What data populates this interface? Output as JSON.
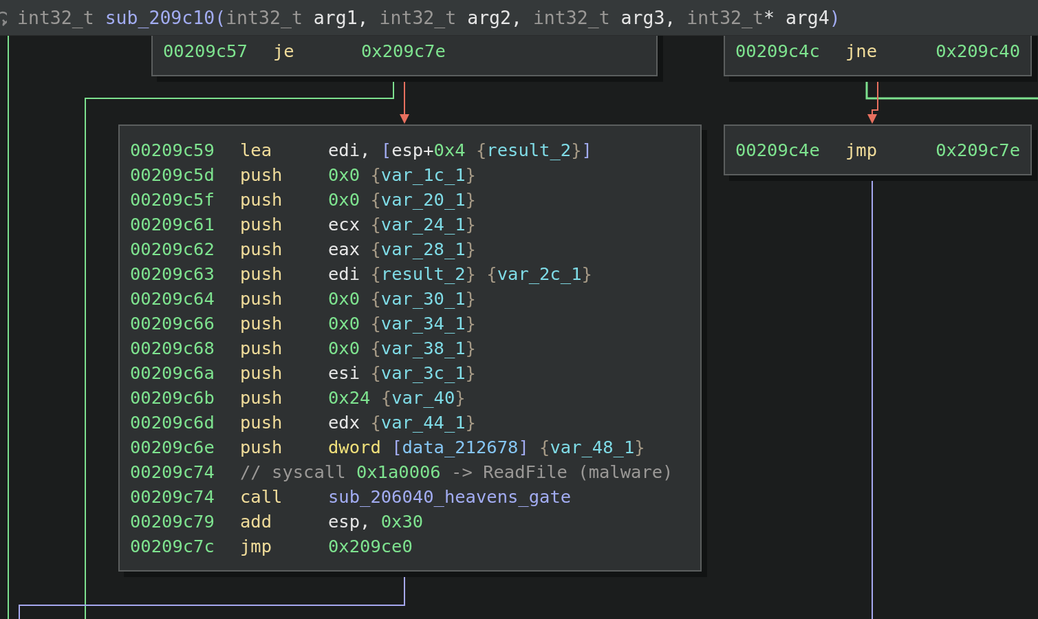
{
  "header": {
    "tokens": [
      {
        "t": "int32_t ",
        "kind": "type"
      },
      {
        "t": "sub_209c10",
        "kind": "sym"
      },
      {
        "t": "(",
        "kind": "paren"
      },
      {
        "t": "int32_t ",
        "kind": "type"
      },
      {
        "t": "arg1, ",
        "kind": "reg"
      },
      {
        "t": "int32_t ",
        "kind": "type"
      },
      {
        "t": "arg2, ",
        "kind": "reg"
      },
      {
        "t": "int32_t ",
        "kind": "type"
      },
      {
        "t": "arg3, ",
        "kind": "reg"
      },
      {
        "t": "int32_t",
        "kind": "type"
      },
      {
        "t": "* arg4",
        "kind": "reg"
      },
      {
        "t": ")",
        "kind": "paren"
      }
    ]
  },
  "blocks": [
    {
      "lines": [
        {
          "kind": "instr",
          "address": "00209c57",
          "mnemonic": "je",
          "operands": [
            {
              "t": "0x209c7e",
              "kind": "imm"
            }
          ]
        }
      ]
    },
    {
      "lines": [
        {
          "kind": "instr",
          "address": "00209c4c",
          "mnemonic": "jne",
          "operands": [
            {
              "t": "0x209c40",
              "kind": "imm"
            }
          ]
        }
      ]
    },
    {
      "lines": [
        {
          "kind": "instr",
          "address": "00209c59",
          "mnemonic": "lea",
          "operands": [
            {
              "t": "edi, ",
              "kind": "reg"
            },
            {
              "t": "[",
              "kind": "bracket"
            },
            {
              "t": "esp+",
              "kind": "reg"
            },
            {
              "t": "0x4",
              "kind": "imm"
            },
            {
              "t": " {",
              "kind": "brace"
            },
            {
              "t": "result_2",
              "kind": "var"
            },
            {
              "t": "}",
              "kind": "brace"
            },
            {
              "t": "]",
              "kind": "bracket"
            }
          ]
        },
        {
          "kind": "instr",
          "address": "00209c5d",
          "mnemonic": "push",
          "operands": [
            {
              "t": "0x0",
              "kind": "imm"
            },
            {
              "t": " {",
              "kind": "brace"
            },
            {
              "t": "var_1c_1",
              "kind": "var"
            },
            {
              "t": "}",
              "kind": "brace"
            }
          ]
        },
        {
          "kind": "instr",
          "address": "00209c5f",
          "mnemonic": "push",
          "operands": [
            {
              "t": "0x0",
              "kind": "imm"
            },
            {
              "t": " {",
              "kind": "brace"
            },
            {
              "t": "var_20_1",
              "kind": "var"
            },
            {
              "t": "}",
              "kind": "brace"
            }
          ]
        },
        {
          "kind": "instr",
          "address": "00209c61",
          "mnemonic": "push",
          "operands": [
            {
              "t": "ecx",
              "kind": "reg"
            },
            {
              "t": " {",
              "kind": "brace"
            },
            {
              "t": "var_24_1",
              "kind": "var"
            },
            {
              "t": "}",
              "kind": "brace"
            }
          ]
        },
        {
          "kind": "instr",
          "address": "00209c62",
          "mnemonic": "push",
          "operands": [
            {
              "t": "eax",
              "kind": "reg"
            },
            {
              "t": " {",
              "kind": "brace"
            },
            {
              "t": "var_28_1",
              "kind": "var"
            },
            {
              "t": "}",
              "kind": "brace"
            }
          ]
        },
        {
          "kind": "instr",
          "address": "00209c63",
          "mnemonic": "push",
          "operands": [
            {
              "t": "edi",
              "kind": "reg"
            },
            {
              "t": " {",
              "kind": "brace"
            },
            {
              "t": "result_2",
              "kind": "var"
            },
            {
              "t": "} {",
              "kind": "brace"
            },
            {
              "t": "var_2c_1",
              "kind": "var"
            },
            {
              "t": "}",
              "kind": "brace"
            }
          ]
        },
        {
          "kind": "instr",
          "address": "00209c64",
          "mnemonic": "push",
          "operands": [
            {
              "t": "0x0",
              "kind": "imm"
            },
            {
              "t": " {",
              "kind": "brace"
            },
            {
              "t": "var_30_1",
              "kind": "var"
            },
            {
              "t": "}",
              "kind": "brace"
            }
          ]
        },
        {
          "kind": "instr",
          "address": "00209c66",
          "mnemonic": "push",
          "operands": [
            {
              "t": "0x0",
              "kind": "imm"
            },
            {
              "t": " {",
              "kind": "brace"
            },
            {
              "t": "var_34_1",
              "kind": "var"
            },
            {
              "t": "}",
              "kind": "brace"
            }
          ]
        },
        {
          "kind": "instr",
          "address": "00209c68",
          "mnemonic": "push",
          "operands": [
            {
              "t": "0x0",
              "kind": "imm"
            },
            {
              "t": " {",
              "kind": "brace"
            },
            {
              "t": "var_38_1",
              "kind": "var"
            },
            {
              "t": "}",
              "kind": "brace"
            }
          ]
        },
        {
          "kind": "instr",
          "address": "00209c6a",
          "mnemonic": "push",
          "operands": [
            {
              "t": "esi",
              "kind": "reg"
            },
            {
              "t": " {",
              "kind": "brace"
            },
            {
              "t": "var_3c_1",
              "kind": "var"
            },
            {
              "t": "}",
              "kind": "brace"
            }
          ]
        },
        {
          "kind": "instr",
          "address": "00209c6b",
          "mnemonic": "push",
          "operands": [
            {
              "t": "0x24",
              "kind": "imm"
            },
            {
              "t": " {",
              "kind": "brace"
            },
            {
              "t": "var_40",
              "kind": "var"
            },
            {
              "t": "}",
              "kind": "brace"
            }
          ]
        },
        {
          "kind": "instr",
          "address": "00209c6d",
          "mnemonic": "push",
          "operands": [
            {
              "t": "edx",
              "kind": "reg"
            },
            {
              "t": " {",
              "kind": "brace"
            },
            {
              "t": "var_44_1",
              "kind": "var"
            },
            {
              "t": "}",
              "kind": "brace"
            }
          ]
        },
        {
          "kind": "instr",
          "address": "00209c6e",
          "mnemonic": "push",
          "operands": [
            {
              "t": "dword ",
              "kind": "keyword"
            },
            {
              "t": "[",
              "kind": "bracket"
            },
            {
              "t": "data_212678",
              "kind": "data"
            },
            {
              "t": "]",
              "kind": "bracket"
            },
            {
              "t": " {",
              "kind": "brace"
            },
            {
              "t": "var_48_1",
              "kind": "var"
            },
            {
              "t": "}",
              "kind": "brace"
            }
          ]
        },
        {
          "kind": "comment",
          "address": "00209c74",
          "tokens": [
            {
              "t": "// syscall ",
              "kind": "comment"
            },
            {
              "t": "0x1a0006",
              "kind": "imm"
            },
            {
              "t": " -> ReadFile (malware)",
              "kind": "comment"
            }
          ]
        },
        {
          "kind": "instr",
          "address": "00209c74",
          "mnemonic": "call",
          "operands": [
            {
              "t": "sub_206040_heavens_gate",
              "kind": "sym"
            }
          ]
        },
        {
          "kind": "instr",
          "address": "00209c79",
          "mnemonic": "add",
          "operands": [
            {
              "t": "esp, ",
              "kind": "reg"
            },
            {
              "t": "0x30",
              "kind": "imm"
            }
          ]
        },
        {
          "kind": "instr",
          "address": "00209c7c",
          "mnemonic": "jmp",
          "operands": [
            {
              "t": "0x209ce0",
              "kind": "imm"
            }
          ]
        }
      ]
    },
    {
      "lines": [
        {
          "kind": "instr",
          "address": "00209c4e",
          "mnemonic": "jmp",
          "operands": [
            {
              "t": "0x209c7e",
              "kind": "imm"
            }
          ]
        }
      ]
    }
  ]
}
